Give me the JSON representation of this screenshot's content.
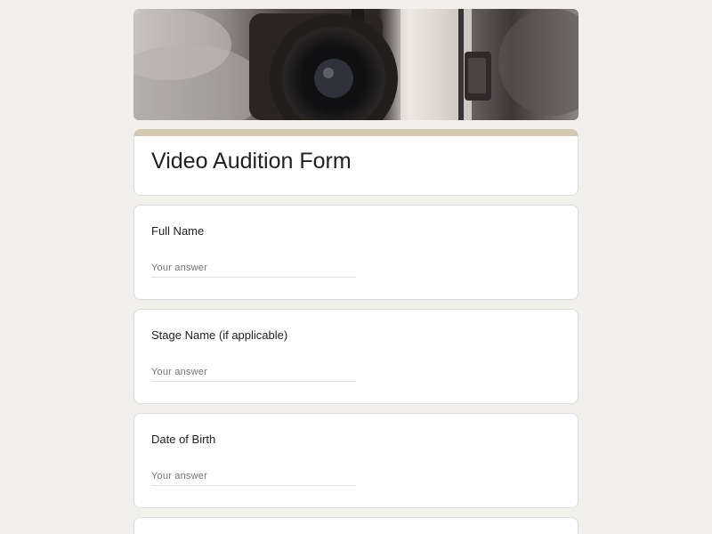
{
  "header": {
    "image_description_icon": "camera-photo"
  },
  "form": {
    "title": "Video Audition Form"
  },
  "questions": [
    {
      "label": "Full Name",
      "placeholder": "Your answer"
    },
    {
      "label": "Stage Name (if applicable)",
      "placeholder": "Your answer"
    },
    {
      "label": "Date of Birth",
      "placeholder": "Your answer"
    }
  ],
  "colors": {
    "page_background": "#f2f0eb",
    "title_accent": "#d6c9b3"
  }
}
